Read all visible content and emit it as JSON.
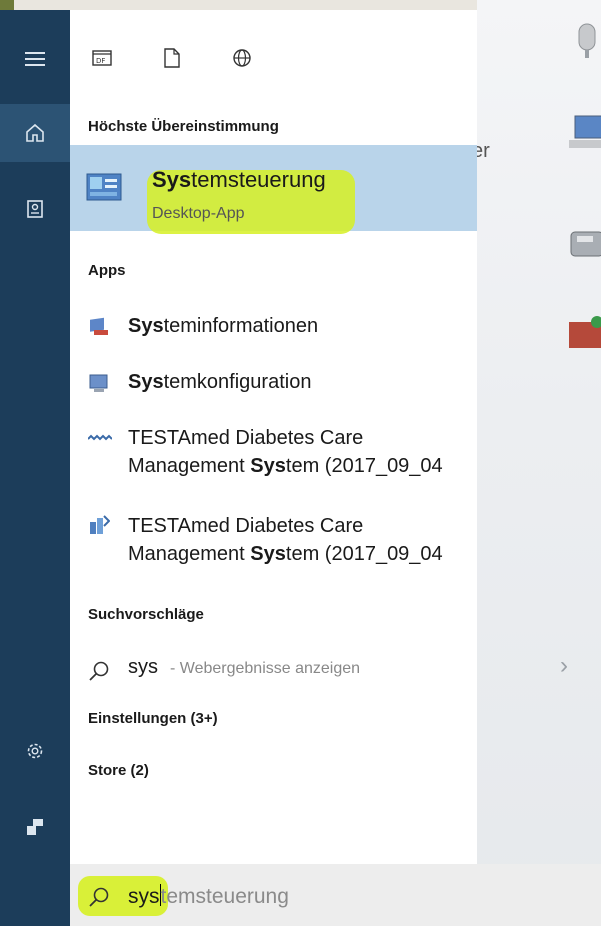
{
  "filters": [
    {
      "icon": "document-app-icon"
    },
    {
      "icon": "blank-document-icon"
    },
    {
      "icon": "globe-icon"
    }
  ],
  "best_match": {
    "header": "Höchste Übereinstimmung",
    "title_match": "Sys",
    "title_rest": "temsteuerung",
    "subtitle": "Desktop-App"
  },
  "apps": {
    "header": "Apps",
    "items": [
      {
        "icon": "system-info-icon",
        "match": "Sys",
        "rest": "teminformationen"
      },
      {
        "icon": "system-config-icon",
        "match": "Sys",
        "rest": "temkonfiguration"
      },
      {
        "icon": "testamed-icon",
        "line1": "TESTAmed Diabetes Care",
        "line2_pre": "Management ",
        "line2_match": "Sys",
        "line2_post": "tem (2017_09_04"
      },
      {
        "icon": "testamed-installer-icon",
        "line1": "TESTAmed Diabetes Care",
        "line2_pre": "Management ",
        "line2_match": "Sys",
        "line2_post": "tem (2017_09_04"
      }
    ]
  },
  "suggestions": {
    "header": "Suchvorschläge",
    "query": "sys",
    "suffix": " - Webergebnisse anzeigen"
  },
  "settings_header": "Einstellungen (3+)",
  "store_header": "Store (2)",
  "search": {
    "typed": "sys",
    "autocomplete": "temsteuerung"
  },
  "behind_text": "er",
  "colors": {
    "rail": "#1c3d5a",
    "selected_row": "#b9d4ea",
    "highlighter": "#d6f023"
  }
}
